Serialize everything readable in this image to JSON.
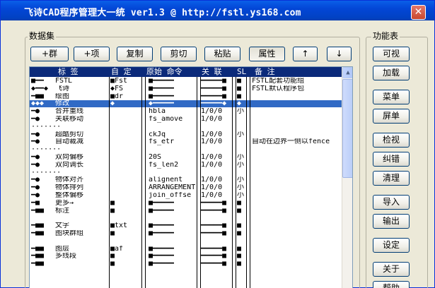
{
  "window": {
    "title": "飞诗CAD程序管理大一统 ver1.3  @ http://fstl.ys168.com",
    "close_glyph": "✕"
  },
  "dataset": {
    "label": "数据集",
    "buttons": [
      "+群",
      "+项",
      "复制",
      "剪切",
      "粘贴",
      "属性",
      "↑",
      "↓"
    ],
    "active_button": "属性"
  },
  "functions": {
    "label": "功能表",
    "buttons": [
      "可视",
      "加载",
      "菜单",
      "屏单",
      "检视",
      "纠错",
      "清理",
      "导入",
      "输出",
      "设定",
      "关于",
      "帮助"
    ]
  },
  "table": {
    "headers": [
      "标    签",
      "自 定",
      "原始 命令",
      "关 联",
      "SL",
      "备    注"
    ],
    "rows": [
      {
        "tree": "■━━",
        "label": "FSTL",
        "custom": "■Fst",
        "cmd": "■━━━━━",
        "assoc": "━━━━━■",
        "sl": "■",
        "note": "FSTL配套功能组"
      },
      {
        "tree": "◆━━◆",
        "label": "飞诗",
        "custom": "◆FS",
        "cmd": "■━━━━━",
        "assoc": "━━━━━■",
        "sl": "■",
        "note": "FSTL默认程序包"
      },
      {
        "tree": " ━■■",
        "label": "绘图",
        "custom": "■dr",
        "cmd": "■━━━━━",
        "assoc": "━━━━━■",
        "sl": "■",
        "note": ""
      },
      {
        "tree": "◆◆◆",
        "label": "修改",
        "custom": "◆",
        "cmd": "◆━━━━━",
        "assoc": "━━━━━◆",
        "sl": "◆",
        "note": "",
        "selected": true
      },
      {
        "tree": "  ━●",
        "label": "合并重线",
        "custom": "",
        "cmd": "hbla",
        "assoc": "1/0/0",
        "sl": "小",
        "note": ""
      },
      {
        "tree": "  ━●",
        "label": "关联移动",
        "custom": "",
        "cmd": "fs_amove",
        "assoc": "1/0/0",
        "sl": "",
        "note": ""
      },
      {
        "tree": "  ·······",
        "label": "",
        "custom": "",
        "cmd": "",
        "assoc": "",
        "sl": "",
        "note": ""
      },
      {
        "tree": "  ━●",
        "label": "超酷剪切",
        "custom": "",
        "cmd": "ckJq",
        "assoc": "1/0/0",
        "sl": "小",
        "note": ""
      },
      {
        "tree": "  ━●",
        "label": "自动裁减",
        "custom": "",
        "cmd": "fs_etr",
        "assoc": "1/0/0",
        "sl": "",
        "note": "自动在边界一侧以fence"
      },
      {
        "tree": "  ·······",
        "label": "",
        "custom": "",
        "cmd": "",
        "assoc": "",
        "sl": "",
        "note": ""
      },
      {
        "tree": "  ━●",
        "label": "双向偏移",
        "custom": "",
        "cmd": "20S",
        "assoc": "1/0/0",
        "sl": "小",
        "note": ""
      },
      {
        "tree": "  ━●",
        "label": "双向调长",
        "custom": "",
        "cmd": "fs_len2",
        "assoc": "1/0/0",
        "sl": "小",
        "note": ""
      },
      {
        "tree": "  ·······",
        "label": "",
        "custom": "",
        "cmd": "",
        "assoc": "",
        "sl": "",
        "note": ""
      },
      {
        "tree": "  ━●",
        "label": "物体对齐",
        "custom": "",
        "cmd": "alignent",
        "assoc": "1/0/0",
        "sl": "小",
        "note": ""
      },
      {
        "tree": "  ━●",
        "label": "物体排列",
        "custom": "",
        "cmd": "ARRANGEMENT",
        "assoc": "1/0/0",
        "sl": "小",
        "note": ""
      },
      {
        "tree": "  ━●",
        "label": "整体偏移",
        "custom": "",
        "cmd": "join_offse",
        "assoc": "1/0/0",
        "sl": "小",
        "note": ""
      },
      {
        "tree": "  ━■",
        "label": "更多→",
        "custom": "■",
        "cmd": "■━━━━━",
        "assoc": "━━━━━■",
        "sl": "■",
        "note": ""
      },
      {
        "tree": " ━■■",
        "label": "标注",
        "custom": "■",
        "cmd": "■━━━━━",
        "assoc": "━━━━━■",
        "sl": "■",
        "note": ""
      },
      {
        "tree": "",
        "label": "",
        "custom": "",
        "cmd": "",
        "assoc": "",
        "sl": "",
        "note": ""
      },
      {
        "tree": " ━■■",
        "label": "文字",
        "custom": "■txt",
        "cmd": "■━━━━━",
        "assoc": "━━━━━■",
        "sl": "■",
        "note": ""
      },
      {
        "tree": " ━■■",
        "label": "图块群组",
        "custom": "■",
        "cmd": "■━━━━━",
        "assoc": "━━━━━■",
        "sl": "■",
        "note": ""
      },
      {
        "tree": "",
        "label": "",
        "custom": "",
        "cmd": "",
        "assoc": "",
        "sl": "",
        "note": ""
      },
      {
        "tree": " ━■■",
        "label": "图层",
        "custom": "■af",
        "cmd": "■━━━━━",
        "assoc": "━━━━━■",
        "sl": "■",
        "note": ""
      },
      {
        "tree": " ━■■",
        "label": "多线段",
        "custom": "■",
        "cmd": "■━━━━━",
        "assoc": "━━━━━■",
        "sl": "■",
        "note": ""
      },
      {
        "tree": " ━■■",
        "label": "",
        "custom": "■",
        "cmd": "■━━━━━",
        "assoc": "━━━━━■",
        "sl": "■",
        "note": ""
      }
    ]
  }
}
